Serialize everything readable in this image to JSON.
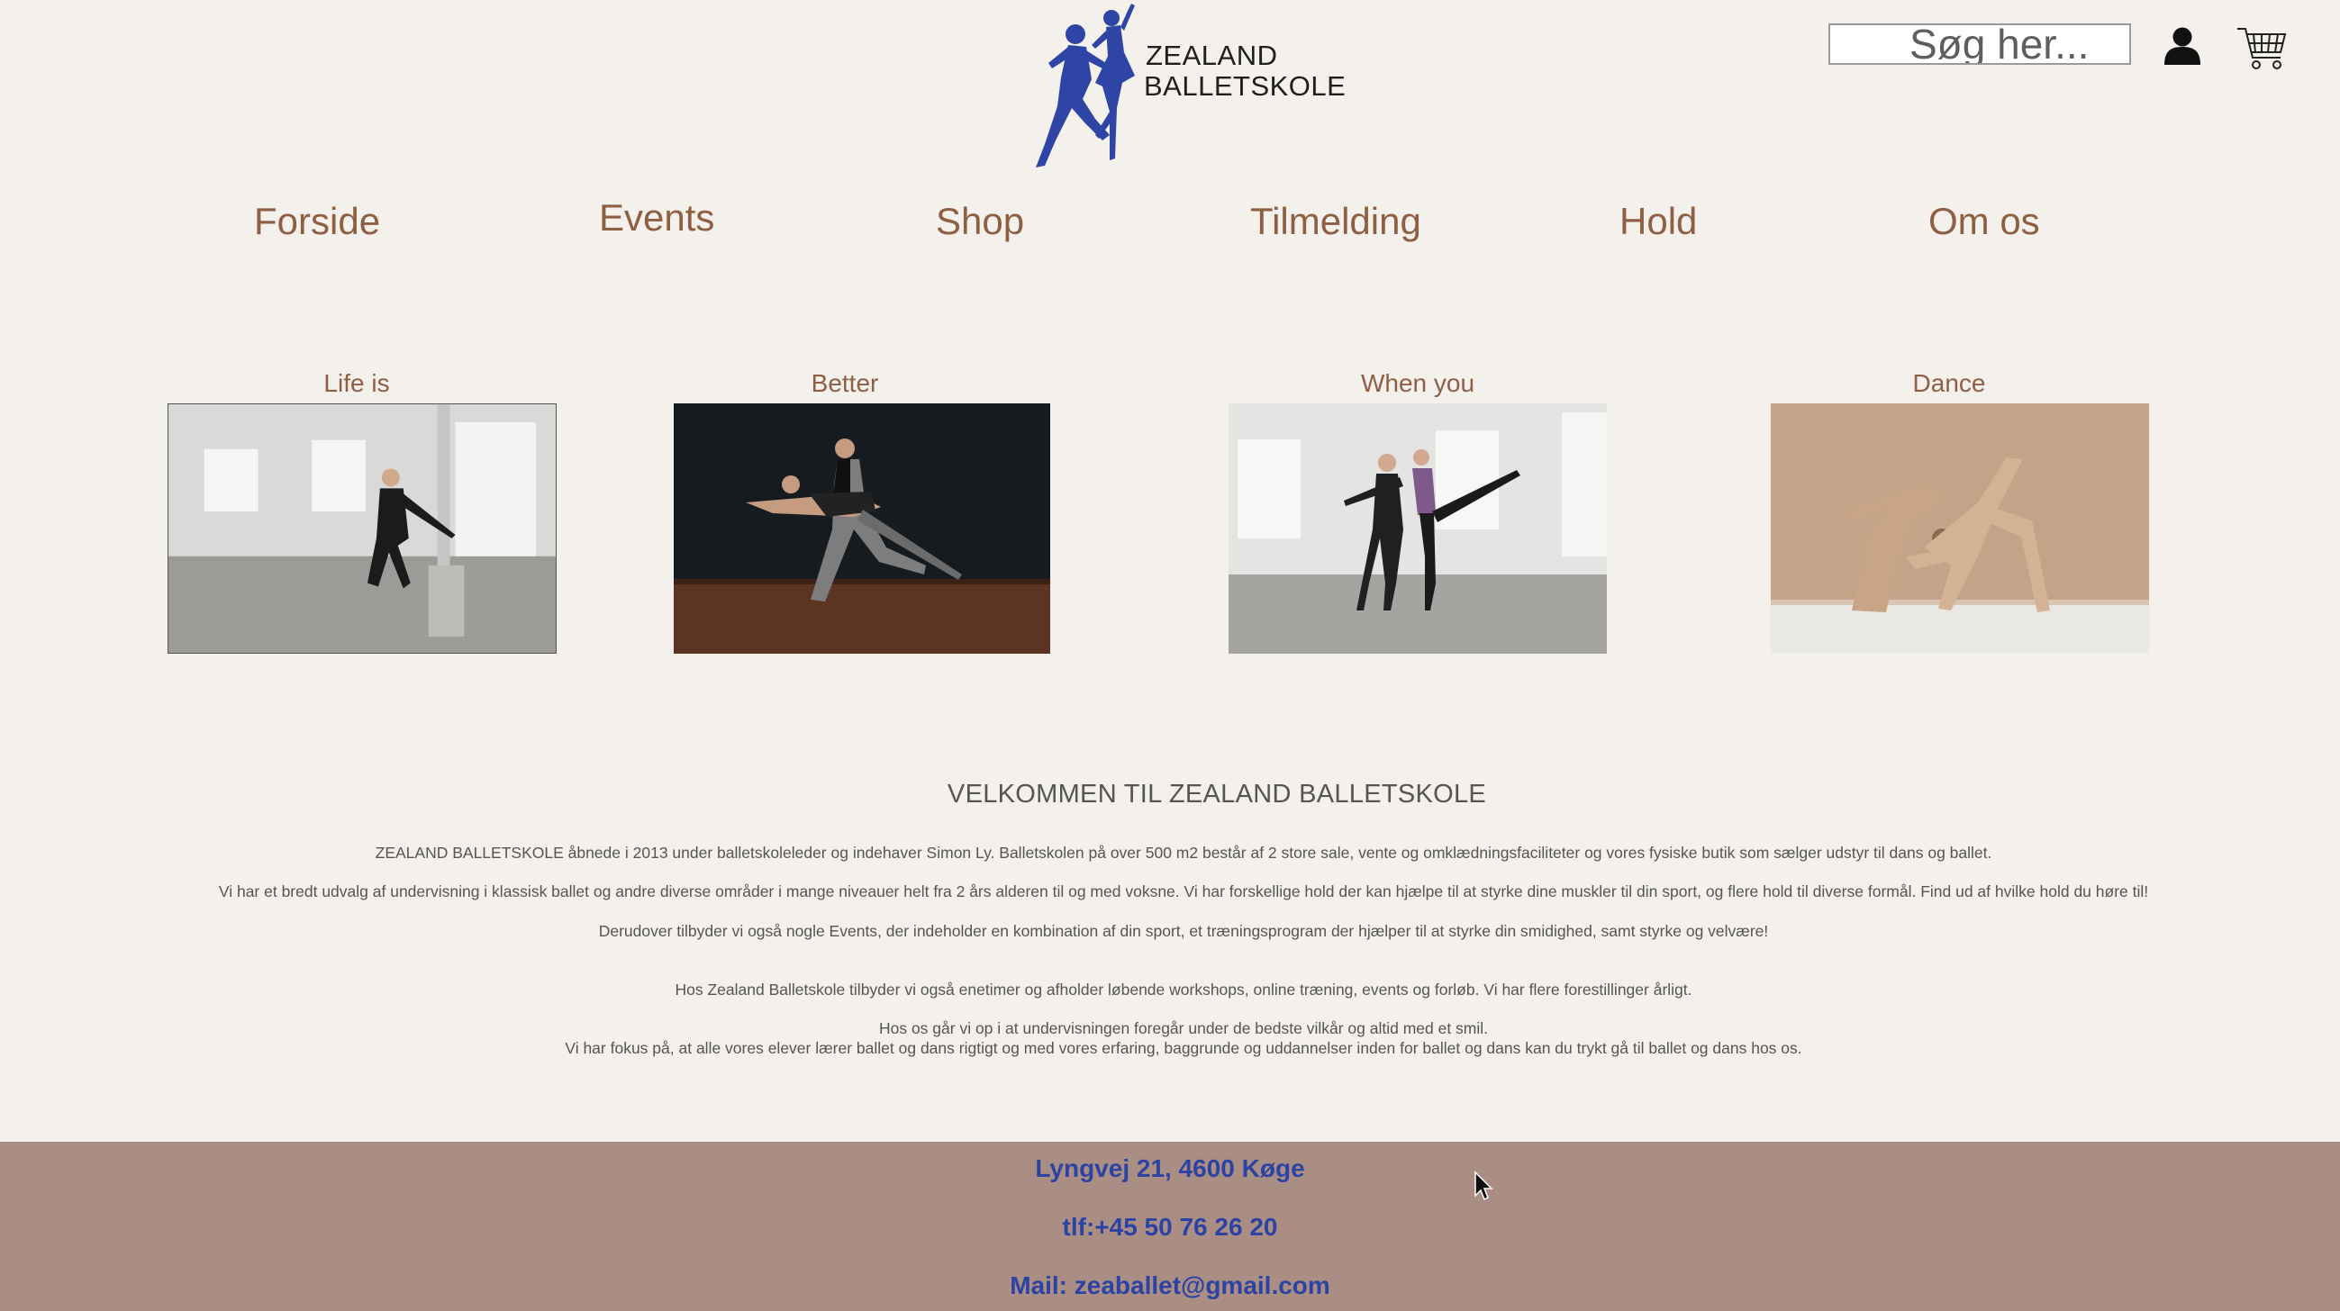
{
  "header": {
    "logo_line1": "ZEALAND",
    "logo_line2": "BALLETSKOLE",
    "search_placeholder": "Søg her...",
    "icons": [
      "user-icon",
      "shopping-cart-icon"
    ]
  },
  "nav": {
    "items": [
      {
        "label": "Forside"
      },
      {
        "label": "Events"
      },
      {
        "label": "Shop"
      },
      {
        "label": "Tilmelding"
      },
      {
        "label": "Hold"
      },
      {
        "label": "Om os"
      }
    ]
  },
  "gallery": {
    "cards": [
      {
        "caption": "Life is"
      },
      {
        "caption": "Better"
      },
      {
        "caption": "When you"
      },
      {
        "caption": "Dance"
      }
    ]
  },
  "welcome": {
    "title": "VELKOMMEN TIL ZEALAND BALLETSKOLE",
    "paragraphs": [
      "ZEALAND BALLETSKOLE åbnede i 2013 under balletskoleleder og indehaver Simon Ly. Balletskolen på over 500 m2 består af 2 store sale, vente og omklædningsfaciliteter og vores fysiske butik som sælger udstyr til dans og ballet.",
      "Vi har et bredt udvalg af undervisning i klassisk ballet og andre diverse områder i mange niveauer helt fra 2 års alderen til og med voksne. Vi har forskellige hold der kan hjælpe til at styrke dine muskler til din sport, og flere hold til diverse formål.  Find ud af hvilke hold du høre til!",
      "Derudover tilbyder vi også nogle Events, der indeholder en kombination af din sport, et træningsprogram der hjælper til at styrke din smidighed, samt styrke og velvære!",
      "Hos Zealand Balletskole tilbyder vi også enetimer og afholder løbende workshops, online træning, events og forløb. Vi har flere forestillinger årligt.",
      "Hos os går vi op i at undervisningen foregår under de bedste vilkår og altid med et smil.",
      "Vi har fokus på, at alle vores elever lærer ballet og dans rigtigt og med vores erfaring, baggrunde og uddannelser inden for ballet og dans kan du trykt gå til ballet og dans hos os."
    ]
  },
  "footer": {
    "address": "Lyngvej 21, 4600 Køge",
    "phone": "tlf:+45 50 76 26 20",
    "mail": "Mail: zeaballet@gmail.com"
  },
  "colors": {
    "background": "#f4f0eb",
    "nav_text": "#8f5f44",
    "logo_blue": "#2f45a6",
    "footer_bg": "#aa8e84",
    "footer_text": "#2d43a3"
  }
}
